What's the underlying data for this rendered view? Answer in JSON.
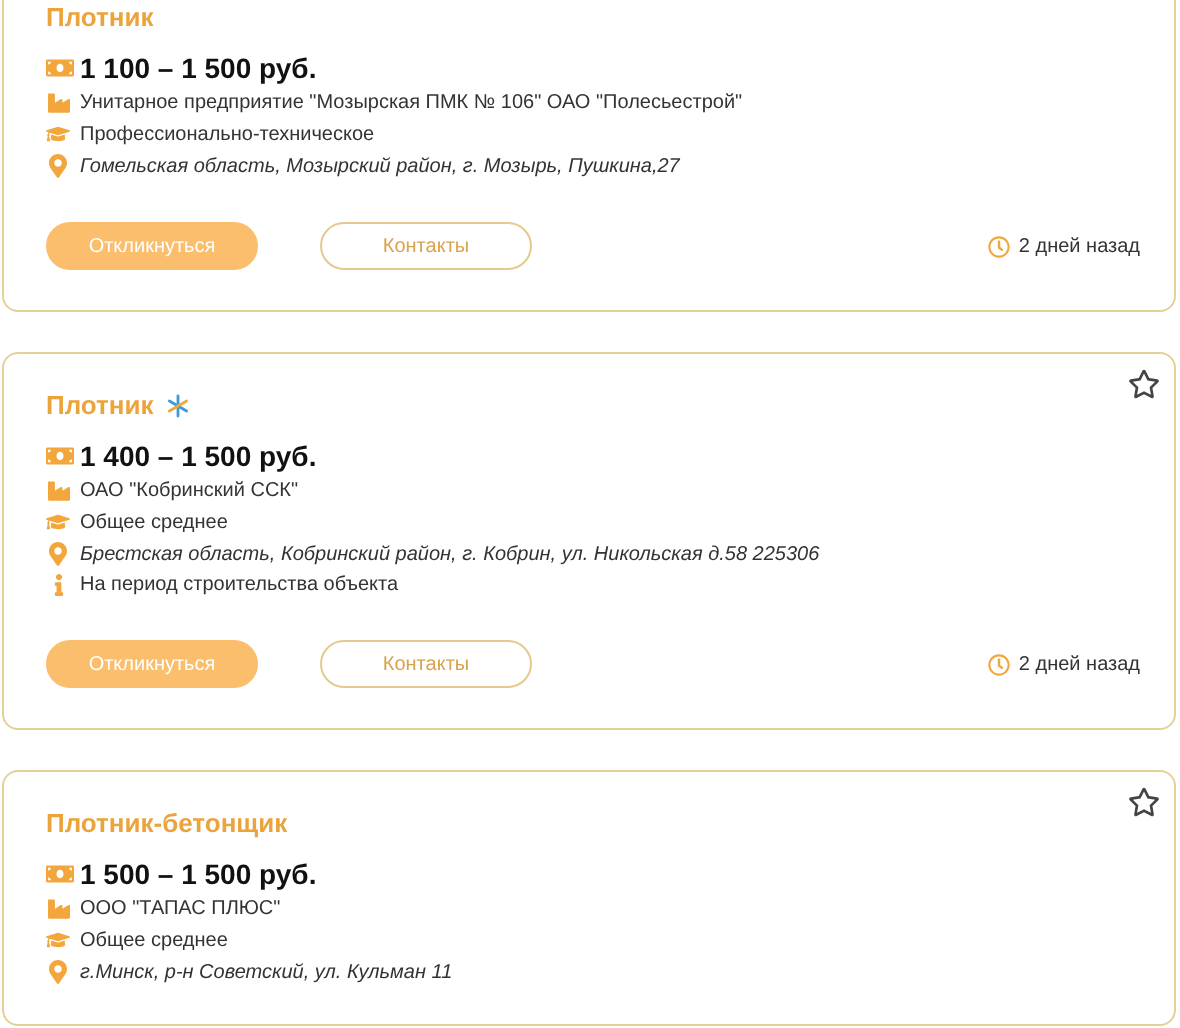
{
  "vacancies": [
    {
      "title": "Плотник",
      "highlighted": false,
      "salary": "1 100 – 1 500 руб.",
      "details": [
        {
          "kind": "company",
          "text": "Унитарное предприятие \"Мозырская ПМК № 106\" ОАО \"Полесьестрой\""
        },
        {
          "kind": "education",
          "text": "Профессионально-техническое"
        },
        {
          "kind": "address",
          "text": "Гомельская область, Мозырский район, г. Мозырь, Пушкина,27"
        }
      ],
      "actions": [
        "Откликнуться",
        "Контакты"
      ],
      "posted": "2 дней назад"
    },
    {
      "title": "Плотник",
      "highlighted": true,
      "favorite": false,
      "salary": "1 400 – 1 500 руб.",
      "details": [
        {
          "kind": "company",
          "text": "ОАО \"Кобринский ССК\""
        },
        {
          "kind": "education",
          "text": "Общее среднее"
        },
        {
          "kind": "address",
          "text": "Брестская область, Кобринский район, г. Кобрин, ул. Никольская д.58 225306"
        },
        {
          "kind": "note",
          "text": "На период строительства объекта"
        }
      ],
      "actions": [
        "Откликнуться",
        "Контакты"
      ],
      "posted": "2 дней назад"
    },
    {
      "title": "Плотник-бетонщик",
      "highlighted": false,
      "favorite": false,
      "salary": "1 500 – 1 500 руб.",
      "details": [
        {
          "kind": "company",
          "text": "ООО \"ТАПАС ПЛЮС\""
        },
        {
          "kind": "education",
          "text": "Общее среднее"
        },
        {
          "kind": "address",
          "text": "г.Минск, р-н Советский, ул. Кульман 11"
        }
      ]
    }
  ]
}
